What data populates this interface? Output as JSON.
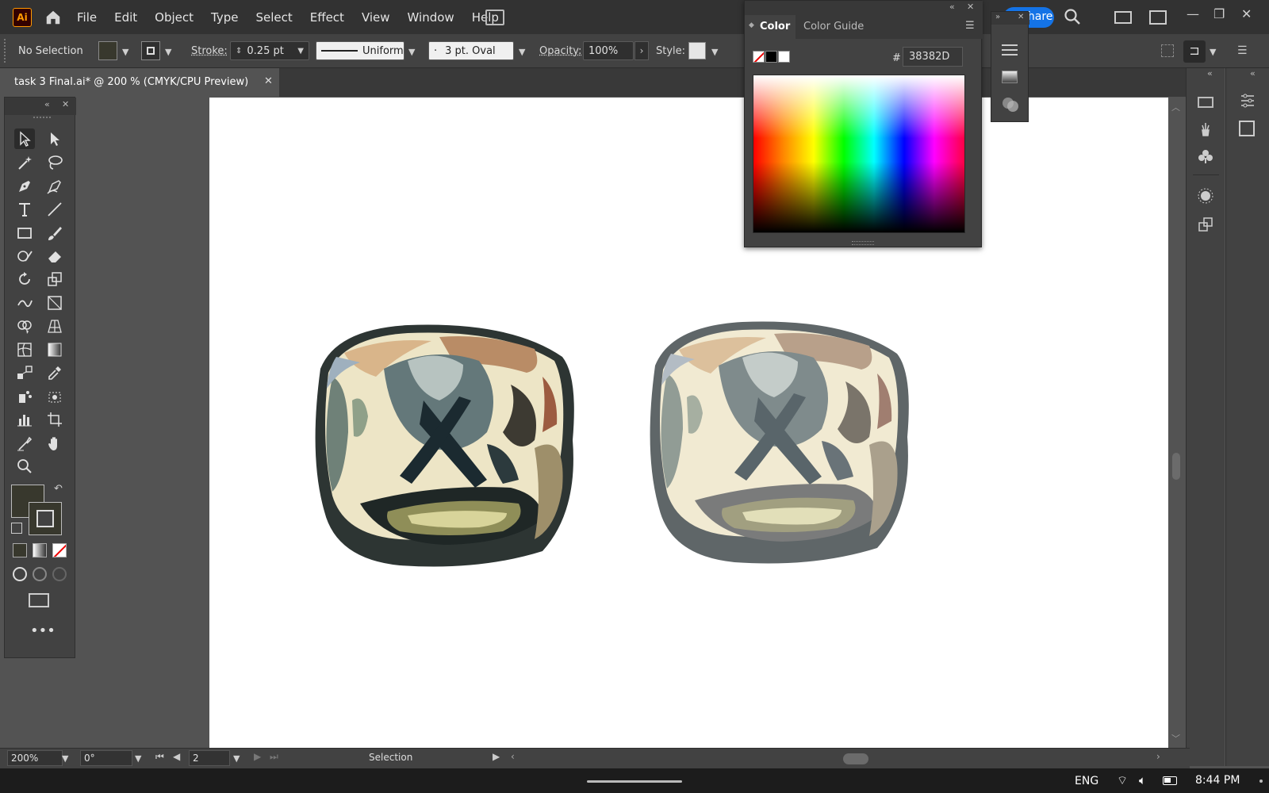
{
  "app": {
    "logo": "Ai",
    "accent": "#ff9a00"
  },
  "menu": [
    "File",
    "Edit",
    "Object",
    "Type",
    "Select",
    "Effect",
    "View",
    "Window",
    "Help"
  ],
  "share_label": "Share",
  "control": {
    "selection": "No Selection",
    "stroke_label": "Stroke:",
    "stroke_value": "0.25 pt",
    "profile": "Uniform",
    "brush": "3 pt. Oval",
    "opacity_label": "Opacity:",
    "opacity_value": "100%",
    "style_label": "Style:"
  },
  "document": {
    "tab_title": "task 3 Final.ai* @ 200 % (CMYK/CPU Preview)"
  },
  "color_panel": {
    "tabs": [
      "Color",
      "Color Guide"
    ],
    "hash": "#",
    "hex": "38382D",
    "fill_color": "#38382d"
  },
  "status": {
    "zoom": "200%",
    "rotation": "0°",
    "artboard_num": "2",
    "tool": "Selection"
  },
  "taskbar": {
    "language": "ENG",
    "time": "8:44 PM"
  },
  "icons": [
    "home-icon",
    "selection-tool-icon",
    "direct-selection-icon",
    "magic-wand-icon",
    "lasso-icon",
    "pen-icon",
    "curvature-icon",
    "type-icon",
    "line-icon",
    "rectangle-icon",
    "paintbrush-icon",
    "shaper-icon",
    "eraser-icon",
    "rotate-icon",
    "scale-icon",
    "warp-icon",
    "free-transform-icon",
    "shape-builder-icon",
    "perspective-grid-icon",
    "mesh-icon",
    "gradient-icon",
    "eyedropper-icon",
    "blend-icon",
    "symbol-sprayer-icon",
    "graph-icon",
    "artboard-icon",
    "slice-icon",
    "hand-icon",
    "zoom-icon"
  ]
}
